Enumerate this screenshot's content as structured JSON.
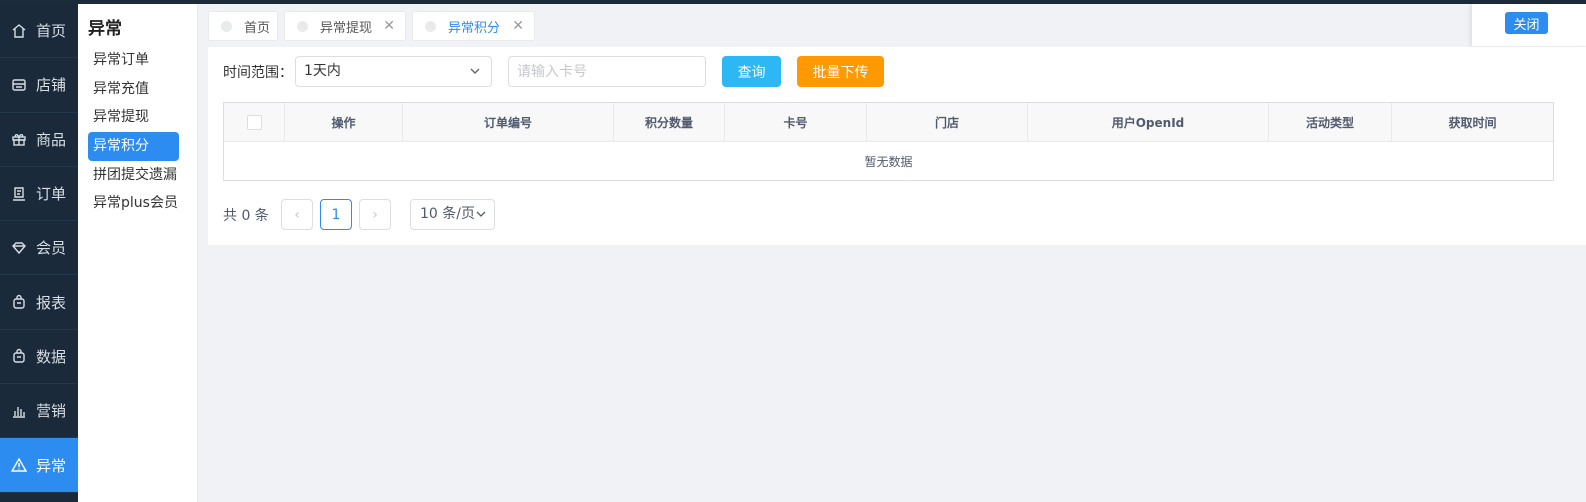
{
  "nav": [
    {
      "label": "首页",
      "icon": "home-icon"
    },
    {
      "label": "店铺",
      "icon": "store-icon"
    },
    {
      "label": "商品",
      "icon": "gift-icon"
    },
    {
      "label": "订单",
      "icon": "order-icon"
    },
    {
      "label": "会员",
      "icon": "diamond-icon"
    },
    {
      "label": "报表",
      "icon": "bag-icon"
    },
    {
      "label": "数据",
      "icon": "bag-icon"
    },
    {
      "label": "营销",
      "icon": "bar-chart-icon"
    },
    {
      "label": "异常",
      "icon": "warning-icon",
      "active": true
    }
  ],
  "submenu": {
    "title": "异常",
    "items": [
      "异常订单",
      "异常充值",
      "异常提现",
      "异常积分",
      "拼团提交遗漏",
      "异常plus会员"
    ],
    "active": "异常积分"
  },
  "tabs": [
    {
      "label": "首页"
    },
    {
      "label": "异常提现",
      "closable": true
    },
    {
      "label": "异常积分",
      "closable": true,
      "active": true
    }
  ],
  "close_label": "关闭",
  "filters": {
    "time_label": "时间范围：",
    "time_value": "1天内",
    "card_placeholder": "请输入卡号",
    "query_label": "查询",
    "upload_label": "批量下传"
  },
  "table": {
    "columns": [
      "操作",
      "订单编号",
      "积分数量",
      "卡号",
      "门店",
      "用户OpenId",
      "活动类型",
      "获取时间"
    ],
    "empty_text": "暂无数据"
  },
  "pagination": {
    "total_text": "共 0 条",
    "current_page": "1",
    "prev": "‹",
    "next": "›",
    "page_size": "10 条/页"
  },
  "colors": {
    "primary": "#2d8cf0",
    "info": "#2db7f5",
    "warning": "#ff9900",
    "nav_bg": "#1b2a3a"
  }
}
